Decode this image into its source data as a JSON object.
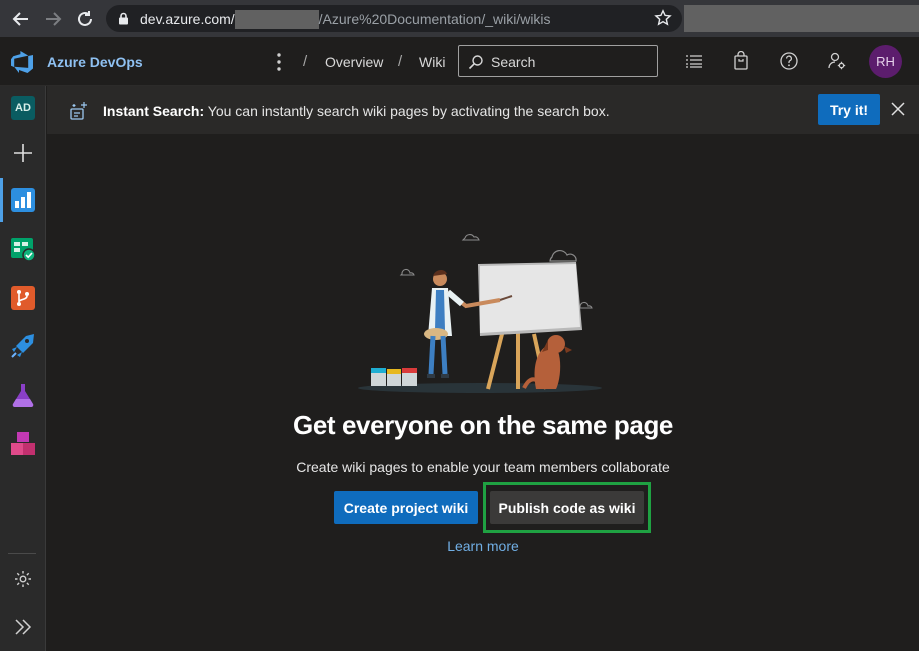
{
  "browser": {
    "url_host": "dev.azure.com/",
    "url_path": "/Azure%20Documentation/_wiki/wikis"
  },
  "header": {
    "brand": "Azure DevOps",
    "breadcrumbs": [
      "Overview",
      "Wiki"
    ],
    "search_placeholder": "Search",
    "avatar_initials": "RH",
    "avatar_color": "#5c1d6d"
  },
  "sidebar": {
    "project_initials": "AD",
    "project_color": "#0a5c61",
    "items": [
      "add",
      "overview",
      "boards",
      "repos",
      "pipelines",
      "test-plans",
      "artifacts"
    ],
    "active_item": "overview"
  },
  "banner": {
    "title": "Instant Search:",
    "message": " You can instantly search wiki pages by activating the search box.",
    "action_label": "Try it!"
  },
  "main": {
    "title": "Get everyone on the same page",
    "subtitle": "Create wiki pages to enable your team members collaborate",
    "primary_button": "Create project wiki",
    "secondary_button": "Publish code as wiki",
    "link": "Learn more",
    "highlight_color": "#1fa142",
    "accent_color": "#0f6cbd"
  }
}
